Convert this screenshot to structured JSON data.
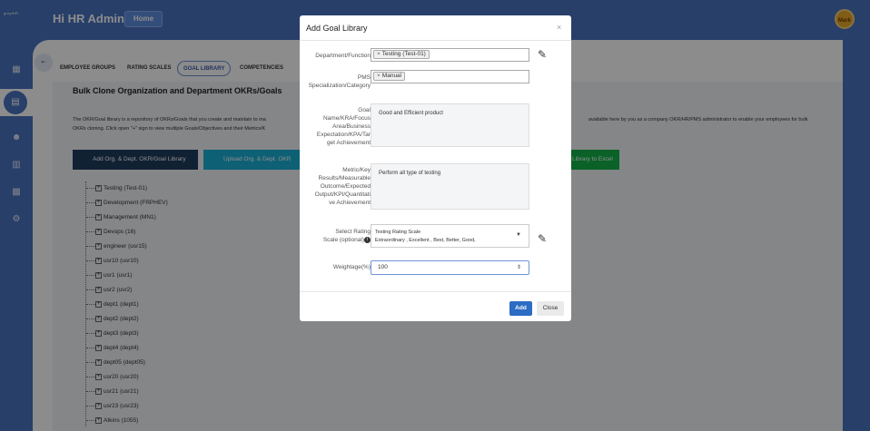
{
  "app": {
    "logo_text": "greytHR",
    "greeting": "Hi HR Admin",
    "home_label": "Home",
    "avatar_text": "Mark"
  },
  "tabs": [
    {
      "label": "EMPLOYEE GROUPS"
    },
    {
      "label": "RATING SCALES"
    },
    {
      "label": "GOAL LIBRARY"
    },
    {
      "label": "COMPETENCIES"
    }
  ],
  "card": {
    "title": "Bulk Clone Organization and Department OKRs/Goals",
    "desc_left_1": "The OKR/Goal library is a repository of OKRs/Goals that you create and maintain to ma",
    "desc_left_2": "OKRs cloning. Click open \"+\" sign to view multiple Goals/Objectives and their Metrics/K",
    "desc_right": "available here by you as a company OKR/HR/PMS administrator to enable your employees for bulk",
    "btn_add": "Add Org. & Dept. OKR/Goal Library",
    "btn_upload": "Upload Org. & Dept. OKR",
    "btn_excel": "Library to Excel"
  },
  "tree": [
    "Testing (Test-01)",
    "Development (FRPHEV)",
    "Management (MN1)",
    "Devops (16)",
    "engineer (usr15)",
    "usr10 (usr10)",
    "usr1 (usr1)",
    "usr2 (usr2)",
    "dept1 (dept1)",
    "dept2 (dept2)",
    "dept3 (dept3)",
    "dept4 (dept4)",
    "dept05 (dept05)",
    "usr20 (usr20)",
    "usr21 (usr21)",
    "usr23 (usr23)",
    "Atkins (1055)"
  ],
  "modal": {
    "title": "Add Goal Library",
    "close": "×",
    "dept_label": "Department/Function",
    "dept_tag": "Testing (Test-01)",
    "pms_label_1": "PMS",
    "pms_label_2": "Specialization/Category",
    "pms_tag": "Manual",
    "goal_label_1": "Goal",
    "goal_label_2": "Name/KRA/Focus",
    "goal_label_3": "Area/Business",
    "goal_label_4": "Expectation/KPA/Tar",
    "goal_label_5": "get Achievement",
    "goal_value": "Good and Efficient product",
    "metric_label_1": "Metric/Key",
    "metric_label_2": "Results/Measurable",
    "metric_label_3": "Outcome/Expected",
    "metric_label_4": "Output/KPI/Quantitati",
    "metric_label_5": "ve Achievement",
    "metric_value": "Perform all type of testing",
    "rating_label_1": "Select Rating",
    "rating_label_2": "Scale (optional)",
    "rating_line_1": "Testing Rating Scale",
    "rating_line_2": "Extraordinary , Excellent , Best, Better, Good,",
    "weight_label": "Weightage(%)",
    "weight_value": "100",
    "add_label": "Add",
    "close_label": "Close"
  }
}
